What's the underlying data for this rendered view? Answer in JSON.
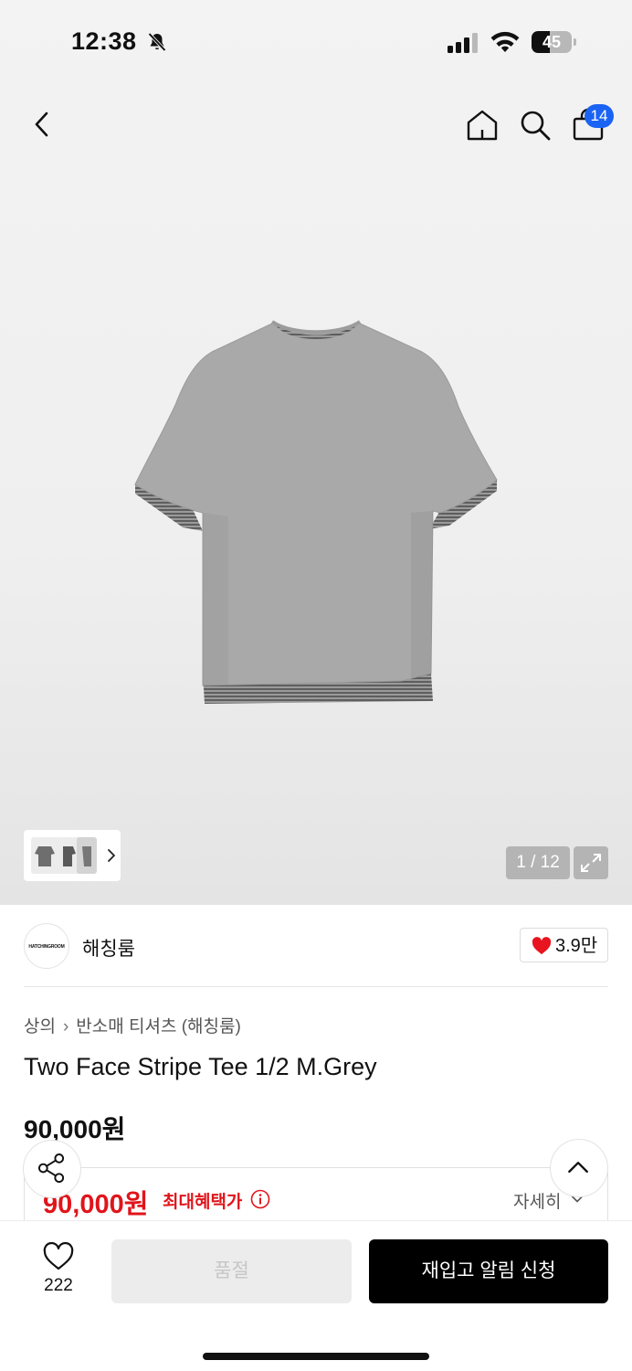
{
  "status_bar": {
    "time": "12:38",
    "battery": "45",
    "battery_level": 0.45,
    "icons": [
      "bell-slash-icon",
      "signal-icon",
      "wifi-icon",
      "battery-icon"
    ]
  },
  "nav": {
    "cart_count": "14",
    "icons": [
      "back-icon",
      "home-icon",
      "search-icon",
      "cart-icon"
    ]
  },
  "gallery": {
    "page_indicator": "1 / 12"
  },
  "brand": {
    "logo_text": "HATCHINGROOM",
    "name": "해칭룸",
    "likes": "3.9만"
  },
  "product": {
    "breadcrumb": [
      "상의",
      "반소매 티셔츠 (해칭룸)"
    ],
    "title": "Two Face Stripe Tee 1/2 M.Grey",
    "price": "90,000원"
  },
  "benefit": {
    "price": "90,000원",
    "label": "최대혜택가",
    "detail_label": "자세히"
  },
  "bottom_bar": {
    "wish_count": "222",
    "soldout_label": "품절",
    "restock_label": "재입고 알림 신청"
  },
  "colors": {
    "accent_blue": "#1b63f3",
    "sale_red": "#e0151b",
    "heart_red": "#e8141f",
    "primary_button": "#000000"
  }
}
